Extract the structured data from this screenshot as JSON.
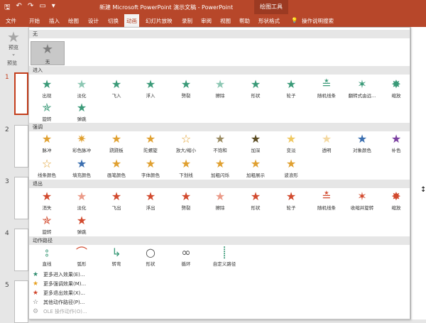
{
  "titlebar": {
    "title": "新建 Microsoft PowerPoint 演示文稿 - PowerPoint",
    "context_tab": "绘图工具",
    "qa_icons": [
      "save-icon",
      "undo-icon",
      "redo-icon",
      "start-icon",
      "customize-icon"
    ]
  },
  "menubar": {
    "tabs": [
      "文件",
      "开始",
      "插入",
      "绘图",
      "设计",
      "切换",
      "动画",
      "幻灯片放映",
      "录制",
      "审阅",
      "视图",
      "帮助",
      "形状格式"
    ],
    "active": "动画",
    "search": "操作说明搜索"
  },
  "ribbon_left": {
    "preview_label": "预览",
    "group_label": "预览"
  },
  "slides": [
    "1",
    "2",
    "3",
    "4",
    "5"
  ],
  "gallery": {
    "sections": {
      "none": "无",
      "entrance": "进入",
      "emphasis": "强调",
      "exit": "退出",
      "path": "动作路径"
    },
    "none_item": "无",
    "entrance": [
      "出现",
      "淡化",
      "飞入",
      "浮入",
      "劈裂",
      "擦除",
      "形状",
      "轮子",
      "随机线条",
      "翻转式由远...",
      "缩放",
      "旋转",
      "弹跳"
    ],
    "emphasis": [
      "脉冲",
      "彩色脉冲",
      "跷跷板",
      "陀螺旋",
      "放大/缩小",
      "不饱和",
      "加深",
      "变淡",
      "透明",
      "对象颜色",
      "补色",
      "线条颜色",
      "填充颜色",
      "画笔颜色",
      "字体颜色",
      "下划线",
      "加粗闪烁",
      "加粗展示",
      "波浪形"
    ],
    "exit": [
      "消失",
      "淡化",
      "飞出",
      "浮出",
      "劈裂",
      "擦除",
      "形状",
      "轮子",
      "随机线条",
      "收缩并旋转",
      "缩放",
      "旋转",
      "弹跳"
    ],
    "path": [
      "直线",
      "弧形",
      "转弯",
      "形状",
      "循环",
      "自定义路径"
    ],
    "more": [
      {
        "label": "更多进入效果(E)...",
        "color": "#2e8b6e",
        "enabled": true
      },
      {
        "label": "更多强调效果(M)...",
        "color": "#e6a020",
        "enabled": true
      },
      {
        "label": "更多退出效果(X)...",
        "color": "#d0442a",
        "enabled": true
      },
      {
        "label": "其他动作路径(P)...",
        "color": "#555555",
        "enabled": true
      },
      {
        "label": "OLE 操作动作(O)...",
        "color": "#a6a6a6",
        "enabled": false
      }
    ]
  },
  "colors": {
    "brand": "#b7472a",
    "entrance": "#3a9a78",
    "emphasis": "#e0a030",
    "exit": "#d24a2e"
  }
}
